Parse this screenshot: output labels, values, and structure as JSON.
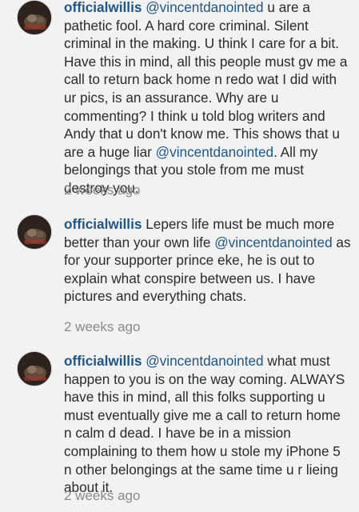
{
  "comments": [
    {
      "username": "officialwillis",
      "segments": [
        {
          "type": "mention",
          "text": "@vincentdanointed"
        },
        {
          "type": "text",
          "text": " u are a pathetic fool. A hard core criminal. Silent criminal in the making. U think I care for a bit. Have this in mind, all this people must gv me a call to return back home n redo wat I did with ur pics, is an assurance. Why are u commenting? I think u told blog writers and Andy that u don't know me. This shows that u are a huge liar "
        },
        {
          "type": "mention",
          "text": "@vincentdanointed"
        },
        {
          "type": "text",
          "text": ". All my belongings that you stole from me must destroy you."
        }
      ],
      "timestamp": "2 weeks ago"
    },
    {
      "username": "officialwillis",
      "segments": [
        {
          "type": "text",
          "text": " Lepers life must be much more better than your own life "
        },
        {
          "type": "mention",
          "text": "@vincentdanointed"
        },
        {
          "type": "text",
          "text": " as for your supporter prince eke, he is out to explain what conspire between us. I have pictures and everything chats."
        }
      ],
      "timestamp": "2 weeks ago"
    },
    {
      "username": "officialwillis",
      "segments": [
        {
          "type": "mention",
          "text": "@vincentdanointed"
        },
        {
          "type": "text",
          "text": " what must happen to you is on the way coming. ALWAYS have this in mind, all this folks supporting u must eventually give me a call to return home n calm d dead. I have be in a mission complaining to them how u stole my iPhone 5 n other belongings at the same time u r lieing about it."
        }
      ],
      "timestamp": "2 weeks ago"
    }
  ],
  "colors": {
    "background": "#f2f2f2",
    "username": "#1f5686",
    "mention": "#1f5686",
    "text": "#2b2b2b",
    "timestamp": "#8a8a8a"
  }
}
